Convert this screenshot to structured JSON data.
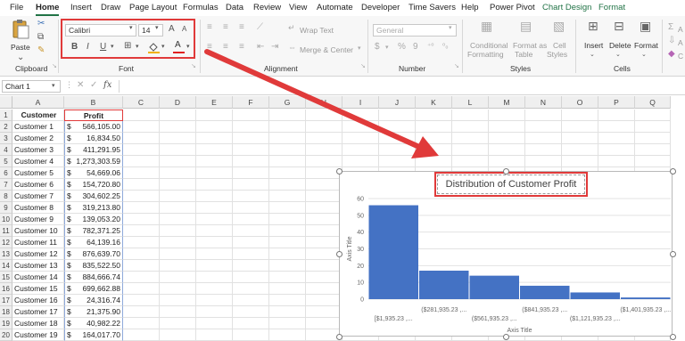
{
  "menu_tabs": [
    "File",
    "Home",
    "Insert",
    "Draw",
    "Page Layout",
    "Formulas",
    "Data",
    "Review",
    "View",
    "Automate",
    "Developer",
    "Time Savers",
    "Help",
    "Power Pivot",
    "Chart Design",
    "Format"
  ],
  "ribbon": {
    "clipboard": {
      "paste_label": "Paste",
      "group_label": "Clipboard"
    },
    "font": {
      "font_name": "Calibri",
      "font_size": "14",
      "bold": "B",
      "italic": "I",
      "underline": "U",
      "grow": "A",
      "shrink": "A",
      "color_a": "A",
      "group_label": "Font"
    },
    "alignment": {
      "wrap_text": "Wrap Text",
      "merge_center": "Merge & Center",
      "group_label": "Alignment"
    },
    "number": {
      "format": "General",
      "currency": "$",
      "percent": "%",
      "comma": "9",
      "group_label": "Number"
    },
    "styles": {
      "conditional": "Conditional",
      "conditional2": "Formatting",
      "format_as": "Format as",
      "format_as2": "Table",
      "cell": "Cell",
      "cell2": "Styles",
      "group_label": "Styles"
    },
    "cells": {
      "insert": "Insert",
      "delete": "Delete",
      "format": "Format",
      "group_label": "Cells"
    },
    "editing": {
      "e1": "A",
      "e2": "A",
      "e3": "C"
    }
  },
  "formula_bar": {
    "name_box": "Chart 1",
    "fx": "fx",
    "content": ""
  },
  "columns": [
    "A",
    "B",
    "C",
    "D",
    "E",
    "F",
    "G",
    "H",
    "I",
    "J",
    "K",
    "L",
    "M",
    "N",
    "O",
    "P",
    "Q"
  ],
  "table": {
    "header": {
      "customer": "Customer",
      "profit": "Profit"
    },
    "rows": [
      {
        "n": "1",
        "customer": "",
        "profit": ""
      },
      {
        "n": "2",
        "customer": "Customer 1",
        "profit": "566,105.00"
      },
      {
        "n": "3",
        "customer": "Customer 2",
        "profit": "16,834.50"
      },
      {
        "n": "4",
        "customer": "Customer 3",
        "profit": "411,291.95"
      },
      {
        "n": "5",
        "customer": "Customer 4",
        "profit": "1,273,303.59"
      },
      {
        "n": "6",
        "customer": "Customer 5",
        "profit": "54,669.06"
      },
      {
        "n": "7",
        "customer": "Customer 6",
        "profit": "154,720.80"
      },
      {
        "n": "8",
        "customer": "Customer 7",
        "profit": "304,602.25"
      },
      {
        "n": "9",
        "customer": "Customer 8",
        "profit": "319,213.80"
      },
      {
        "n": "10",
        "customer": "Customer 9",
        "profit": "139,053.20"
      },
      {
        "n": "11",
        "customer": "Customer 10",
        "profit": "782,371.25"
      },
      {
        "n": "12",
        "customer": "Customer 11",
        "profit": "64,139.16"
      },
      {
        "n": "13",
        "customer": "Customer 12",
        "profit": "876,639.70"
      },
      {
        "n": "14",
        "customer": "Customer 13",
        "profit": "835,522.50"
      },
      {
        "n": "15",
        "customer": "Customer 14",
        "profit": "884,666.74"
      },
      {
        "n": "16",
        "customer": "Customer 15",
        "profit": "699,662.88"
      },
      {
        "n": "17",
        "customer": "Customer 16",
        "profit": "24,316.74"
      },
      {
        "n": "18",
        "customer": "Customer 17",
        "profit": "21,375.90"
      },
      {
        "n": "19",
        "customer": "Customer 18",
        "profit": "40,982.22"
      },
      {
        "n": "20",
        "customer": "Customer 19",
        "profit": "164,017.70"
      }
    ],
    "currency_symbol": "$"
  },
  "chart_data": {
    "type": "bar",
    "title": "Distribution  of Customer Profit",
    "xlabel": "Axis Title",
    "ylabel": "Axis Title",
    "ylim": [
      0,
      60
    ],
    "yticks": [
      "0",
      "10",
      "20",
      "30",
      "40",
      "50",
      "60"
    ],
    "categories": [
      "[$1,935.23 ,...",
      "($281,935.23 ,...",
      "($561,935.23 ,...",
      "($841,935.23 ,...",
      "($1,121,935.23 ,...",
      "($1,401,935.23 ,..."
    ],
    "values": [
      56,
      17,
      14,
      8,
      4,
      1
    ],
    "bar_color": "#4472c4"
  },
  "colors": {
    "accent": "#217346",
    "highlight": "#e03a3a",
    "bar": "#4472c4"
  }
}
